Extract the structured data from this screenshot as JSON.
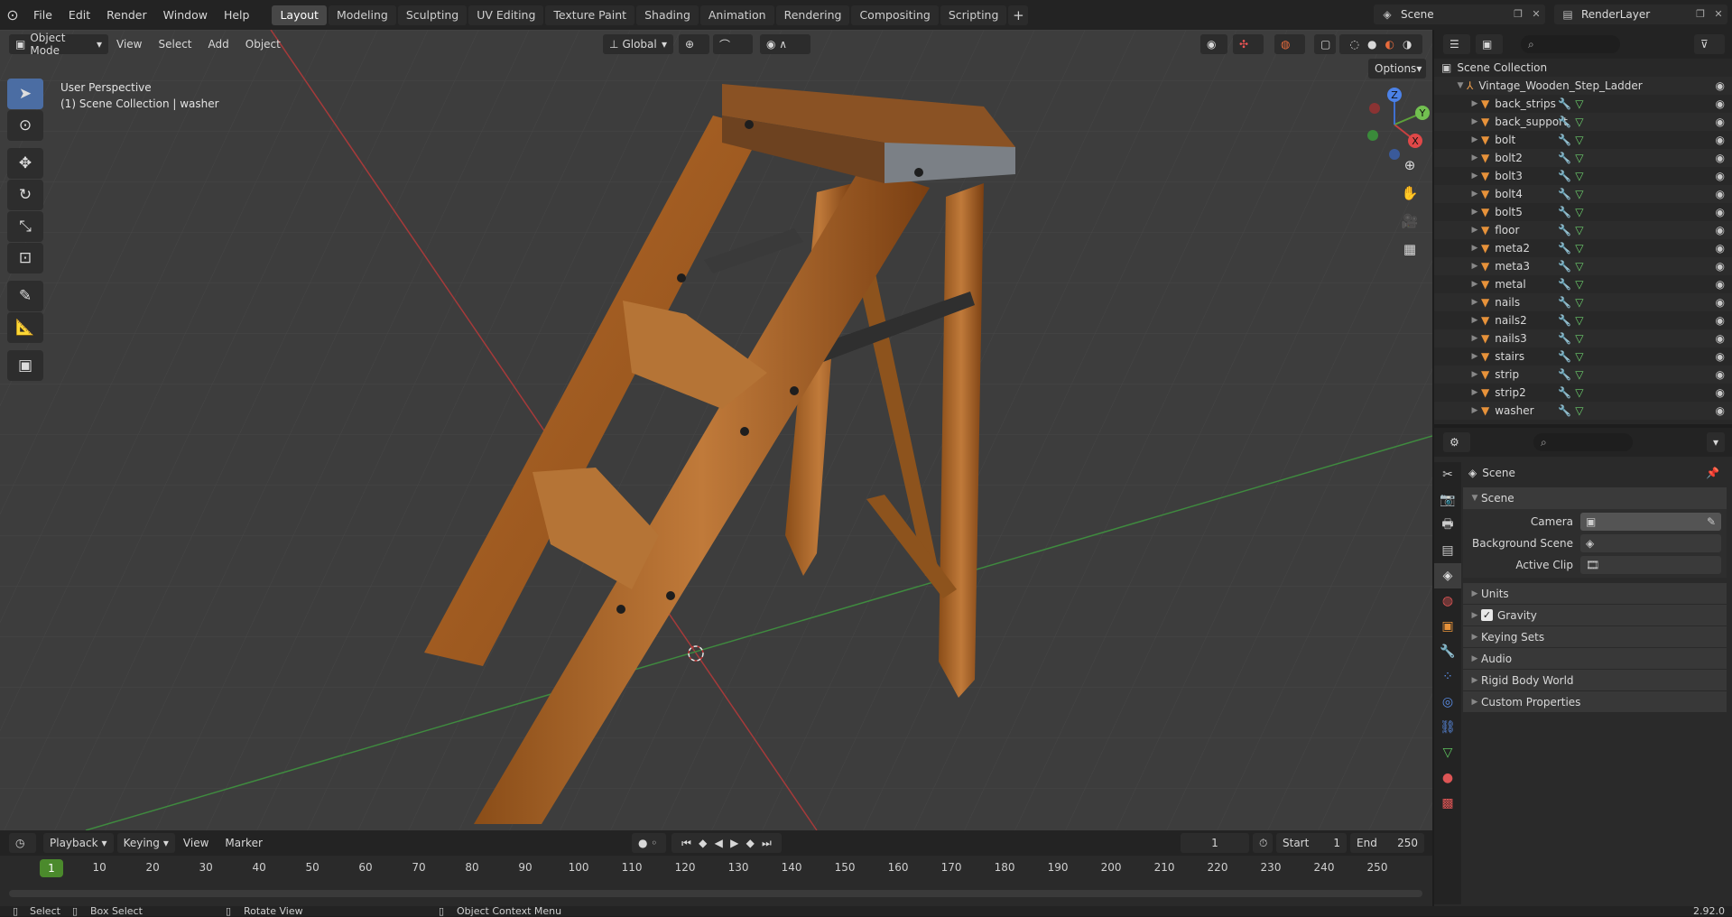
{
  "menu": [
    "File",
    "Edit",
    "Render",
    "Window",
    "Help"
  ],
  "workspaces": [
    "Layout",
    "Modeling",
    "Sculpting",
    "UV Editing",
    "Texture Paint",
    "Shading",
    "Animation",
    "Rendering",
    "Compositing",
    "Scripting"
  ],
  "workspace_add": "+",
  "scene_name": "Scene",
  "render_layer": "RenderLayer",
  "viewport": {
    "mode": "Object Mode",
    "menus": [
      "View",
      "Select",
      "Add",
      "Object"
    ],
    "transform": "Global",
    "options": "Options",
    "perspective": "User Perspective",
    "collection_info": "(1) Scene Collection | washer",
    "gizmo": {
      "x": "X",
      "y": "Y",
      "z": "Z"
    }
  },
  "outliner": {
    "root": "Scene Collection",
    "collection": "Vintage_Wooden_Step_Ladder",
    "objects": [
      "back_strips",
      "back_support",
      "bolt",
      "bolt2",
      "bolt3",
      "bolt4",
      "bolt5",
      "floor",
      "meta2",
      "meta3",
      "metal",
      "nails",
      "nails2",
      "nails3",
      "stairs",
      "strip",
      "strip2",
      "washer"
    ]
  },
  "properties": {
    "context": "Scene",
    "panel": "Scene",
    "fields": [
      {
        "label": "Camera",
        "value": ""
      },
      {
        "label": "Background Scene",
        "value": ""
      },
      {
        "label": "Active Clip",
        "value": ""
      }
    ],
    "subpanels": [
      "Units",
      "Gravity",
      "Keying Sets",
      "Audio",
      "Rigid Body World",
      "Custom Properties"
    ]
  },
  "timeline": {
    "menus": [
      "Playback",
      "Keying",
      "View",
      "Marker"
    ],
    "current_frame": "1",
    "start_label": "Start",
    "start": "1",
    "end_label": "End",
    "end": "250",
    "ticks": [
      "1",
      "10",
      "20",
      "30",
      "40",
      "50",
      "60",
      "70",
      "80",
      "90",
      "100",
      "110",
      "120",
      "130",
      "140",
      "150",
      "160",
      "170",
      "180",
      "190",
      "200",
      "210",
      "220",
      "230",
      "240",
      "250"
    ]
  },
  "status": {
    "select": "Select",
    "box_select": "Box Select",
    "rotate": "Rotate View",
    "context_menu": "Object Context Menu",
    "version": "2.92.0"
  }
}
